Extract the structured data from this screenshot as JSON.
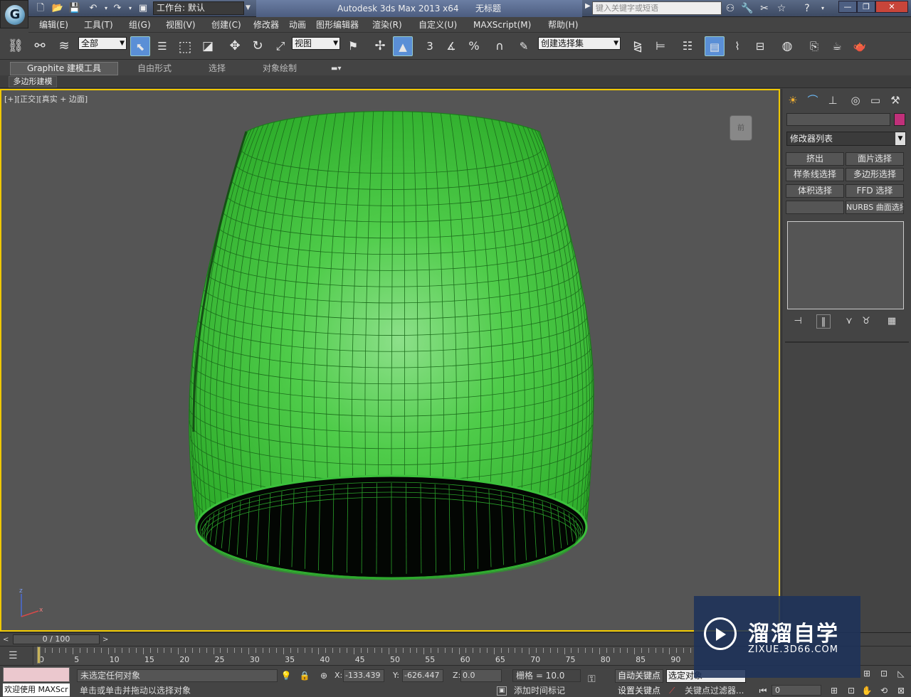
{
  "titlebar": {
    "workspace": "工作台: 默认",
    "app_title": "Autodesk 3ds Max  2013 x64",
    "doc_title": "无标题",
    "search_placeholder": "键入关键字或短语"
  },
  "menu": [
    "编辑(E)",
    "工具(T)",
    "组(G)",
    "视图(V)",
    "创建(C)",
    "修改器",
    "动画",
    "图形编辑器",
    "渲染(R)",
    "自定义(U)",
    "MAXScript(M)",
    "帮助(H)"
  ],
  "toolbar": {
    "selection_filter": "全部",
    "ref_coord": "视图",
    "named_selection": "创建选择集",
    "snap_label": "3",
    "percent_label": "%"
  },
  "ribbon": {
    "tabs": [
      "Graphite 建模工具",
      "自由形式",
      "选择",
      "对象绘制"
    ],
    "sub_tab": "多边形建模"
  },
  "viewport": {
    "label_a": "[+]",
    "label_b": "[正交]",
    "label_c": "[真实 + 边面]",
    "axis_z": "z",
    "axis_x": "x",
    "viewcube_label": "前"
  },
  "command_panel": {
    "modifier_list": "修改器列表",
    "buttons": [
      "挤出",
      "面片选择",
      "样条线选择",
      "多边形选择",
      "体积选择",
      "FFD 选择",
      "",
      "NURBS 曲面选择"
    ]
  },
  "timeline": {
    "frame_display": "0 / 100",
    "prev": "<",
    "next": ">",
    "ticks": [
      "0",
      "5",
      "10",
      "15",
      "20",
      "25",
      "30",
      "35",
      "40",
      "45",
      "50",
      "55",
      "60",
      "65",
      "70",
      "75",
      "80",
      "85",
      "90"
    ]
  },
  "status": {
    "welcome": "欢迎使用 MAXScr",
    "line1": "未选定任何对象",
    "line2": "单击或单击并拖动以选择对象",
    "x_label": "X:",
    "x_value": "-133.439",
    "y_label": "Y:",
    "y_value": "-626.447",
    "z_label": "Z:",
    "z_value": "0.0",
    "grid": "栅格 = 10.0",
    "add_time_tag": "添加时间标记",
    "auto_key": "自动关键点",
    "set_key": "设置关键点",
    "key_select": "选定对象",
    "key_filter": "关键点过滤器...",
    "frame_value": "0"
  },
  "watermark": {
    "main": "溜溜自学",
    "sub": "ZIXUE.3D66.COM"
  },
  "colors": {
    "object_green": "#3cc13c",
    "viewport_border": "#f0c800",
    "object_color_swatch": "#c0307a"
  }
}
